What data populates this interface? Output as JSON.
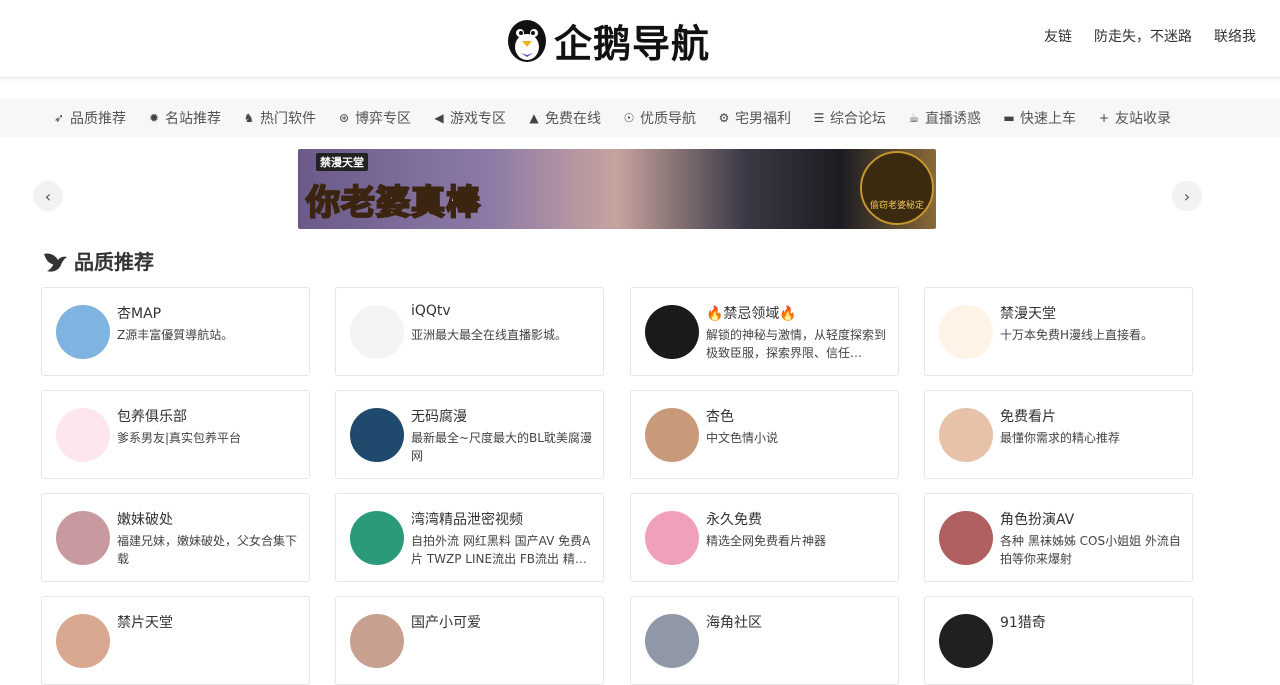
{
  "header": {
    "logo_text": "企鹅导航",
    "links": [
      "友链",
      "防走失，不迷路",
      "联络我"
    ]
  },
  "nav": [
    {
      "icon": "bird-icon",
      "label": "品质推荐"
    },
    {
      "icon": "maple-leaf-icon",
      "label": "名站推荐"
    },
    {
      "icon": "wolf-icon",
      "label": "热门软件"
    },
    {
      "icon": "chip-icon",
      "label": "博弈专区"
    },
    {
      "icon": "megaphone-icon",
      "label": "游戏专区"
    },
    {
      "icon": "flask-icon",
      "label": "免费在线"
    },
    {
      "icon": "medal-icon",
      "label": "优质导航"
    },
    {
      "icon": "gear-icon",
      "label": "宅男福利"
    },
    {
      "icon": "signpost-icon",
      "label": "综合论坛"
    },
    {
      "icon": "cup-icon",
      "label": "直播诱惑"
    },
    {
      "icon": "truck-icon",
      "label": "快速上车"
    },
    {
      "icon": "plus-icon",
      "label": "友站收录"
    }
  ],
  "banner": {
    "brand": "禁漫天堂",
    "title": "你老婆真棒",
    "badge": "偷窃老婆秘定"
  },
  "section": {
    "title": "品质推荐"
  },
  "cards": [
    {
      "name": "杏MAP",
      "desc": "Z源丰富優質導航站。",
      "color": "#7fb3e0"
    },
    {
      "name": "iQQtv",
      "desc": "亚洲最大最全在线直播影城。",
      "color": "#f4f4f4"
    },
    {
      "name": "🔥禁忌领域🔥",
      "desc": "解锁的神秘与激情，从轻度探索到极致臣服，探索界限、信任…",
      "color": "#1a1a1a"
    },
    {
      "name": "禁漫天堂",
      "desc": "十万本免费H漫线上直接看。",
      "color": "#fdf3e6"
    },
    {
      "name": "包养俱乐部",
      "desc": "爹系男友|真实包养平台",
      "color": "#fde6ee"
    },
    {
      "name": "无码腐漫",
      "desc": "最新最全~尺度最大的BL耽美腐漫网",
      "color": "#1f4a6e"
    },
    {
      "name": "杏色",
      "desc": "中文色情小说",
      "color": "#c89a7a"
    },
    {
      "name": "免费看片",
      "desc": "最懂你需求的精心推荐",
      "color": "#e8c2a8"
    },
    {
      "name": "嫩妹破处",
      "desc": "福建兄妹，嫩妹破处，父女合集下载",
      "color": "#c89aa0"
    },
    {
      "name": "湾湾精品泄密视频",
      "desc": "自拍外流 网红黑料 国产AV 免费A片 TWZP LINE流出 FB流出 精…",
      "color": "#2a9a7a"
    },
    {
      "name": "永久免费",
      "desc": "精选全网免费看片神器",
      "color": "#f0a0b8"
    },
    {
      "name": "角色扮演AV",
      "desc": "各种 黑袜姊姊 COS小姐姐 外流自拍等你来爆射",
      "color": "#b06060"
    },
    {
      "name": "禁片天堂",
      "desc": "",
      "color": "#d8a890"
    },
    {
      "name": "国产小可爱",
      "desc": "",
      "color": "#c8a090"
    },
    {
      "name": "海角社区",
      "desc": "",
      "color": "#9098a8"
    },
    {
      "name": "91猎奇",
      "desc": "",
      "color": "#202020"
    }
  ]
}
